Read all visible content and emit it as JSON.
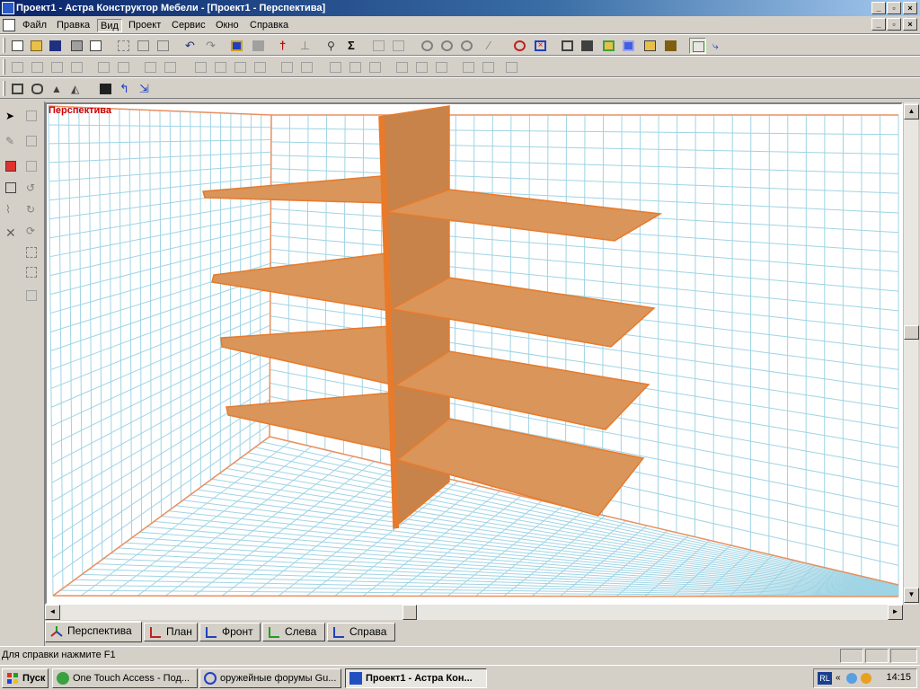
{
  "window": {
    "title": "Проект1 - Астра Конструктор Мебели - [Проект1 - Перспектива]"
  },
  "menu": {
    "items": [
      "Файл",
      "Правка",
      "Вид",
      "Проект",
      "Сервис",
      "Окно",
      "Справка"
    ],
    "pressed": "Вид"
  },
  "viewport": {
    "label": "Перспектива",
    "colors": {
      "grid": "#9fd4e4",
      "room_edge": "#e89060",
      "shelf_top": "#d9955a",
      "shelf_edge": "#e87a2a",
      "panel": "#c8834a"
    }
  },
  "tabs": [
    {
      "label": "Перспектива",
      "icon": "axes-3d-icon",
      "active": true
    },
    {
      "label": "План",
      "icon": "plan-view-icon",
      "active": false
    },
    {
      "label": "Фронт",
      "icon": "front-view-icon",
      "active": false
    },
    {
      "label": "Слева",
      "icon": "left-view-icon",
      "active": false
    },
    {
      "label": "Справа",
      "icon": "right-view-icon",
      "active": false
    }
  ],
  "status": {
    "text": "Для справки нажмите F1"
  },
  "taskbar": {
    "start_label": "Пуск",
    "tasks": [
      {
        "label": "One Touch Access - Под...",
        "active": false
      },
      {
        "label": "оружейные форумы Gu...",
        "active": false
      },
      {
        "label": "Проект1 - Астра Кон...",
        "active": true
      }
    ],
    "language": "RL",
    "clock": "14:15"
  }
}
